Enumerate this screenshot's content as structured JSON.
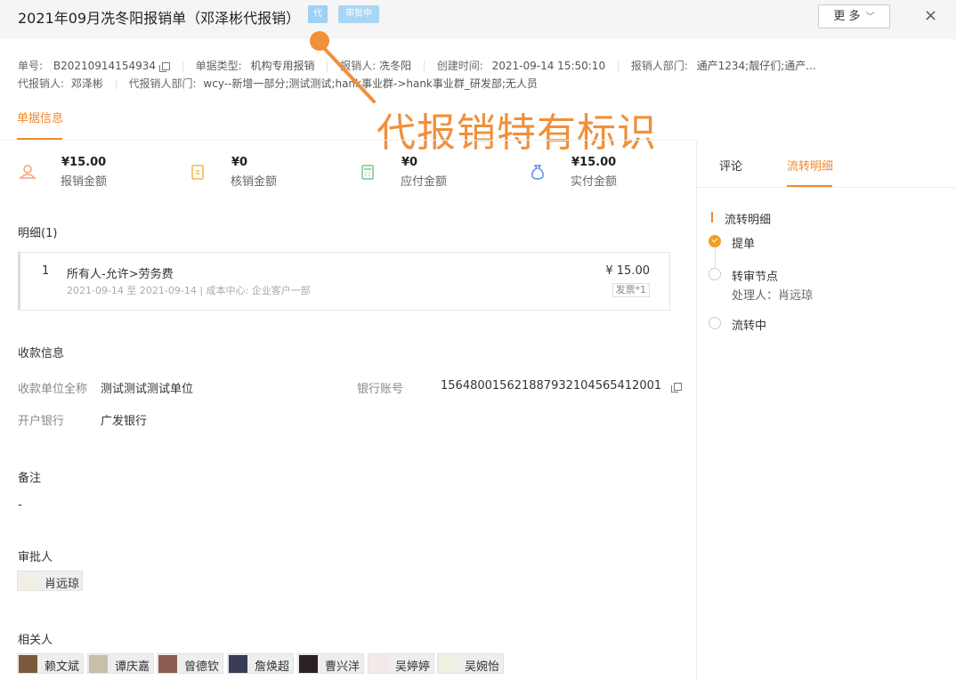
{
  "header": {
    "title": "2021年09月冼冬阳报销单（邓泽彬代报销）",
    "tag_proxy": "代",
    "tag_status": "审批中",
    "more_label": "更 多",
    "close_label": "×"
  },
  "meta": {
    "order_no_label": "单号:",
    "order_no": "B20210914154934",
    "type_label": "单据类型:",
    "type": "机构专用报销",
    "claimant_label": "报销人:",
    "claimant": "冼冬阳",
    "created_label": "创建时间:",
    "created": "2021-09-14 15:50:10",
    "dept_label": "报销人部门:",
    "dept": "通产1234;靓仔们;通产...",
    "proxy_label": "代报销人:",
    "proxy": "邓泽彬",
    "proxy_dept_label": "代报销人部门:",
    "proxy_dept": "wcy--新增一部分;测试测试;hank事业群->hank事业群_研发部;无人员"
  },
  "tabs": {
    "main": "单据信息"
  },
  "amounts": [
    {
      "value": "¥15.00",
      "label": "报销金额",
      "icon": "wallet-icon",
      "color": "#f5a27a"
    },
    {
      "value": "¥0",
      "label": "核销金额",
      "icon": "voucher-icon",
      "color": "#f0b84a"
    },
    {
      "value": "¥0",
      "label": "应付金额",
      "icon": "calculator-icon",
      "color": "#7cc58a"
    },
    {
      "value": "¥15.00",
      "label": "实付金额",
      "icon": "money-bag-icon",
      "color": "#5a8fe0"
    }
  ],
  "detail": {
    "title": "明细(1)",
    "items": [
      {
        "index": "1",
        "name": "所有人-允许>劳务费",
        "sub": "2021-09-14 至 2021-09-14 | 成本中心:  企业客户一部",
        "price": "¥ 15.00",
        "invoice": "发票*1"
      }
    ]
  },
  "payee": {
    "title": "收款信息",
    "name_label": "收款单位全称",
    "name": "测试测试测试单位",
    "account_label": "银行账号",
    "account": "156480015621887932104565412001",
    "bank_label": "开户银行",
    "bank": "广发银行"
  },
  "remark": {
    "title": "备注",
    "value": "-"
  },
  "approver": {
    "title": "审批人",
    "names": [
      "肖远琼"
    ]
  },
  "related": {
    "title": "相关人",
    "names": [
      "赖文斌",
      "谭庆嘉",
      "曾德钦",
      "詹焕超",
      "曹兴洋",
      "吴婷婷",
      "吴婉怡"
    ]
  },
  "right_panel": {
    "tabs": [
      "评论",
      "流转明细"
    ],
    "flow_title": "流转明细",
    "steps": [
      {
        "name": "提单",
        "status": "done"
      },
      {
        "name": "转审节点",
        "handler": "处理人：肖远琼",
        "status": "pending"
      },
      {
        "name": "流转中",
        "status": "pending"
      }
    ]
  },
  "annotation": {
    "text": "代报销特有标识",
    "color": "#f0903a"
  },
  "colors": {
    "accent": "#f08a2c",
    "tag_blue": "#9fd0f5"
  }
}
